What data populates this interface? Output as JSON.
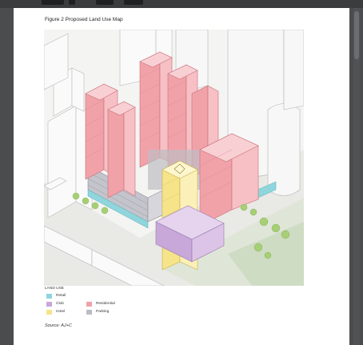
{
  "figure": {
    "title": "Figure 2 Proposed Land Use Map",
    "source": "Source: AJ+C"
  },
  "legend": {
    "title": "LAND USE",
    "items": [
      {
        "label": "Retail",
        "color": "#8ed6dc"
      },
      {
        "label": "Club",
        "color": "#c7a8d8"
      },
      {
        "label": "Residential",
        "color": "#f0a2a8"
      },
      {
        "label": "Hotel",
        "color": "#f5e48a"
      },
      {
        "label": "Parking",
        "color": "#bcbcc4"
      }
    ]
  }
}
